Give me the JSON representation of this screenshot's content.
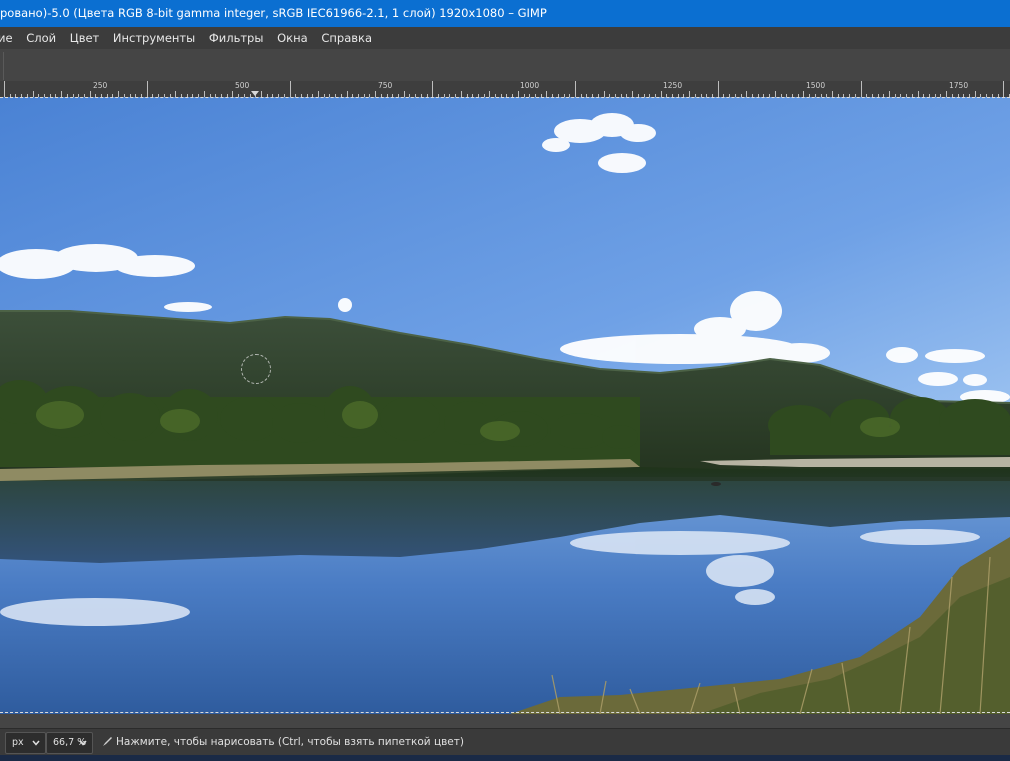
{
  "window": {
    "title": "ровано)-5.0 (Цвета RGB 8-bit gamma integer, sRGB IEC61966-2.1, 1 слой) 1920x1080 – GIMP"
  },
  "menu": {
    "items": [
      "ие",
      "Слой",
      "Цвет",
      "Инструменты",
      "Фильтры",
      "Окна",
      "Справка"
    ]
  },
  "ruler": {
    "labels": [
      "250",
      "500",
      "750",
      "1000",
      "1250",
      "1500",
      "1750"
    ]
  },
  "status": {
    "unit": "px",
    "zoom": "66,7 %",
    "message": "Нажмите, чтобы нарисовать (Ctrl, чтобы взять пипеткой цвет)"
  },
  "colors": {
    "titlebar": "#0b6fd1",
    "menubar": "#3c3c3c",
    "workspace": "#454545",
    "sky_top": "#4f86d6",
    "sky_bottom": "#9cc3f0"
  },
  "icons": [
    "chevron-down-icon",
    "paintbrush-icon"
  ]
}
